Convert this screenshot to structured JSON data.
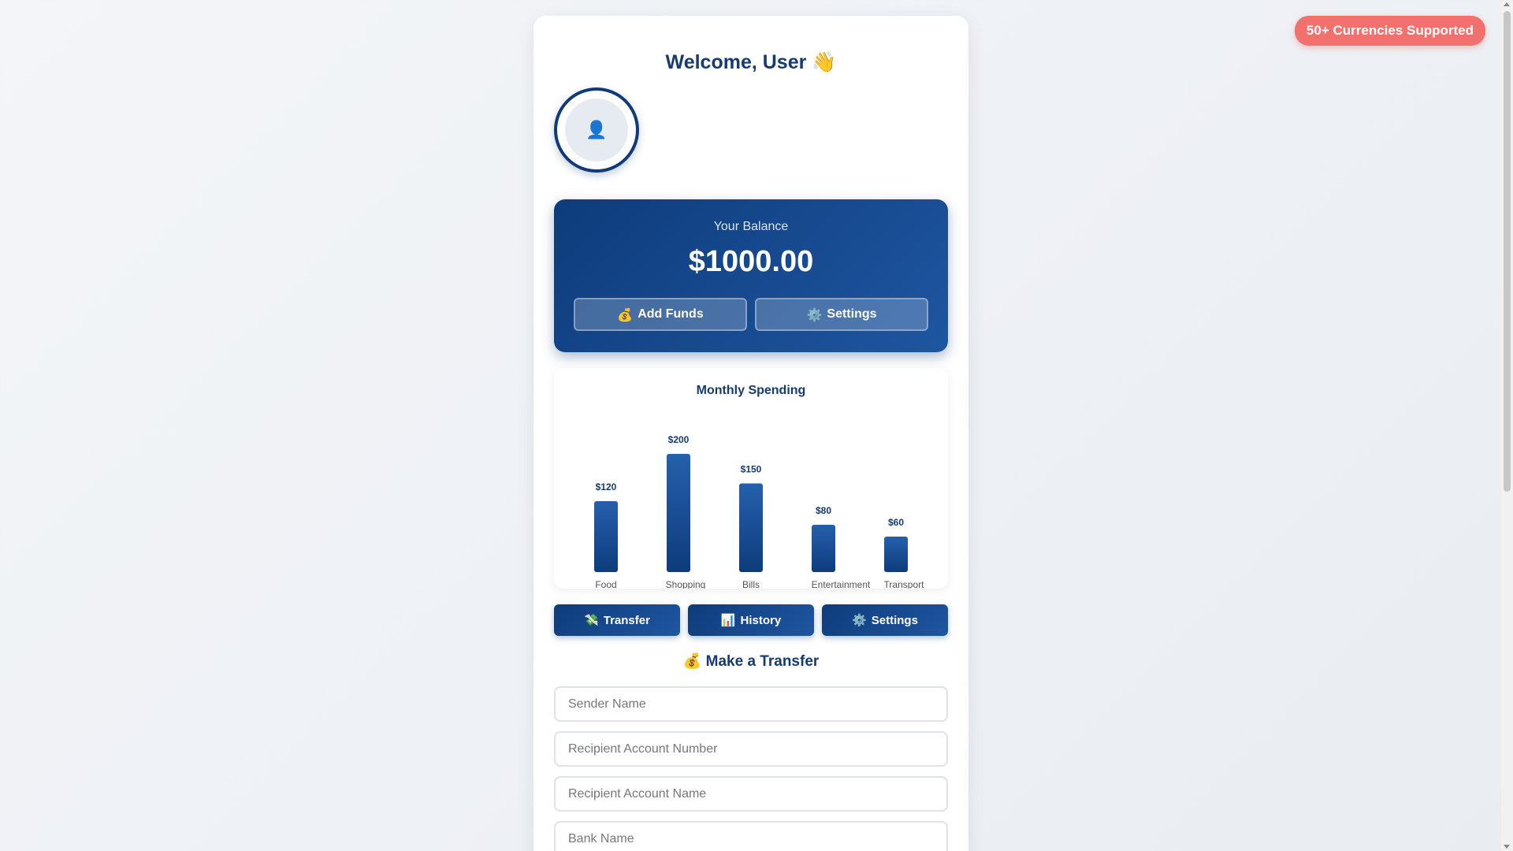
{
  "badge": {
    "label": "50+ Currencies Supported"
  },
  "header": {
    "welcome": "Welcome, User",
    "wave_icon": "👋"
  },
  "avatar": {
    "icon": "👤"
  },
  "balance": {
    "label": "Your Balance",
    "amount": "$1000.00",
    "add_funds": {
      "icon": "💰",
      "label": "Add Funds"
    },
    "settings": {
      "icon": "⚙️",
      "label": "Settings"
    }
  },
  "chart_data": {
    "type": "bar",
    "title": "Monthly Spending",
    "categories": [
      "Food",
      "Shopping",
      "Bills",
      "Entertainment",
      "Transport"
    ],
    "values": [
      120,
      200,
      150,
      80,
      60
    ],
    "value_labels": [
      "$120",
      "$200",
      "$150",
      "$80",
      "$60"
    ],
    "ylim": [
      0,
      200
    ],
    "grid": false,
    "colors": {
      "bar_top": "#2560ac",
      "bar_bottom": "#0e3c7c",
      "label": "#163a72",
      "axis_text": "#555555"
    }
  },
  "nav": {
    "transfer": {
      "icon": "💸",
      "label": "Transfer"
    },
    "history": {
      "icon": "📊",
      "label": "History"
    },
    "settings": {
      "icon": "⚙️",
      "label": "Settings"
    }
  },
  "transfer": {
    "title_icon": "💰",
    "title": "Make a Transfer",
    "fields": {
      "sender_name": {
        "placeholder": "Sender Name",
        "value": ""
      },
      "recipient_account_number": {
        "placeholder": "Recipient Account Number",
        "value": ""
      },
      "recipient_account_name": {
        "placeholder": "Recipient Account Name",
        "value": ""
      },
      "bank_name": {
        "placeholder": "Bank Name",
        "value": ""
      }
    }
  },
  "colors": {
    "primary": "#0e3c7c",
    "accent": "#f2706e",
    "heading": "#163a72"
  }
}
